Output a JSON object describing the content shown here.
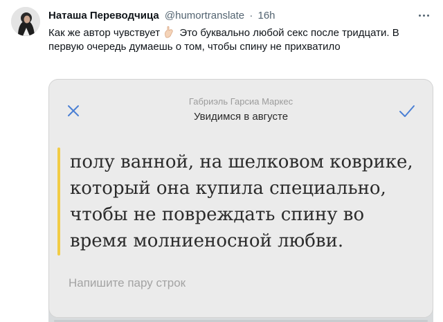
{
  "tweet": {
    "author_name": "Наташа Переводчица",
    "author_handle": "@humortranslate",
    "separator": "·",
    "time": "16h",
    "text_before_emoji": "Как же автор чувствует",
    "emoji": "hand-emoji",
    "text_after_emoji": "Это буквально любой секс после тридцати. В первую очередь думаешь о том, чтобы спину не прихватило"
  },
  "book_card": {
    "author": "Габриэль Гарсиа Маркес",
    "title": "Увидимся в августе",
    "quote_lines": [
      "полу ванной, на шелковом коврике,",
      "который она купила специально,",
      "чтобы не повреждать спину во",
      "время молниеносной любви."
    ],
    "note_placeholder": "Напишите пару строк"
  },
  "colors": {
    "accent_blue": "#4a7fd4",
    "highlight_yellow": "#f2cc45"
  }
}
